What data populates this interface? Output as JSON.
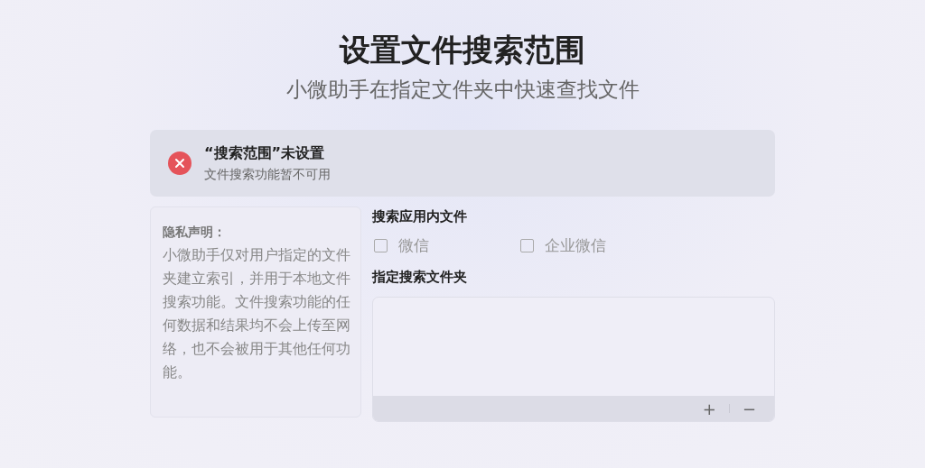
{
  "header": {
    "title": "设置文件搜索范围",
    "subtitle": "小微助手在指定文件夹中快速查找文件"
  },
  "alert": {
    "kind": "error",
    "title": "“搜索范围”未设置",
    "message": "文件搜索功能暂不可用"
  },
  "privacy": {
    "title": "隐私声明：",
    "text": "小微助手仅对用户指定的文件夹建立索引，并用于本地文件搜索功能。文件搜索功能的任何数据和结果均不会上传至网络，也不会被用于其他任何功能。"
  },
  "app_search": {
    "label": "搜索应用内文件",
    "options": [
      {
        "label": "微信",
        "checked": false,
        "disabled": true
      },
      {
        "label": "企业微信",
        "checked": false,
        "disabled": true
      }
    ]
  },
  "folders": {
    "label": "指定搜索文件夹",
    "buttons": [
      "+",
      "−"
    ]
  }
}
